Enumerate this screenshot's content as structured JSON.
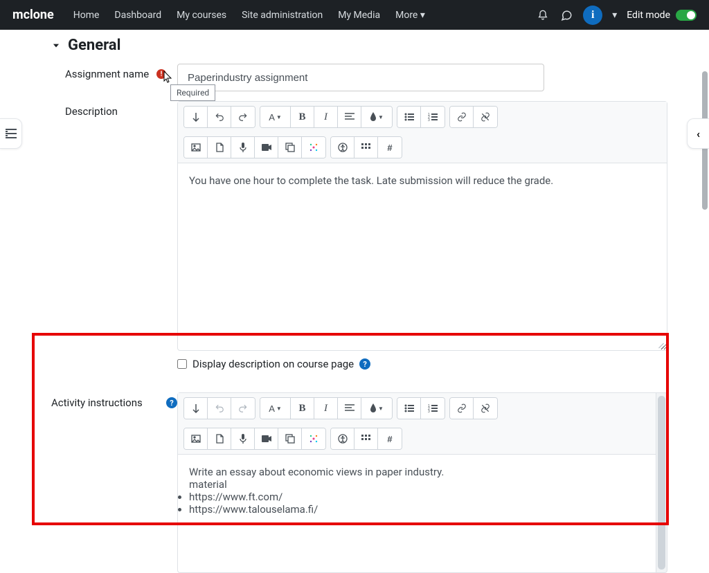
{
  "nav": {
    "brand": "mclone",
    "links": [
      "Home",
      "Dashboard",
      "My courses",
      "Site administration",
      "My Media",
      "More"
    ],
    "edit_mode_label": "Edit mode",
    "avatar_letter": "i"
  },
  "section": {
    "title": "General"
  },
  "assignment_name": {
    "label": "Assignment name",
    "value": "Paperindustry assignment",
    "required_tooltip": "Required"
  },
  "description": {
    "label": "Description",
    "content": "You have one hour to complete the task. Late submission will reduce the grade."
  },
  "display_desc": {
    "label": "Display description on course page",
    "checked": false
  },
  "instructions": {
    "label": "Activity instructions",
    "essay_line": "Write an essay about economic views in paper industry.",
    "material_label": "material",
    "links": [
      "https://www.ft.com/",
      "https://www.talouselama.fi/"
    ]
  },
  "toolbar_icons": {
    "expand": "↧",
    "undo": "↺",
    "redo": "↻",
    "style": "A",
    "bold": "B",
    "italic": "I",
    "bullets": "•≡",
    "numbers": "1≡",
    "link": "🔗",
    "unlink": "✕🔗",
    "image": "🖼",
    "file": "📄",
    "mic": "🎤",
    "video": "■",
    "copy": "⧉",
    "sparkle": "✳",
    "a11y": "◉",
    "grid": "▦",
    "hash": "#",
    "paragraph": "≡",
    "color": "💧"
  }
}
